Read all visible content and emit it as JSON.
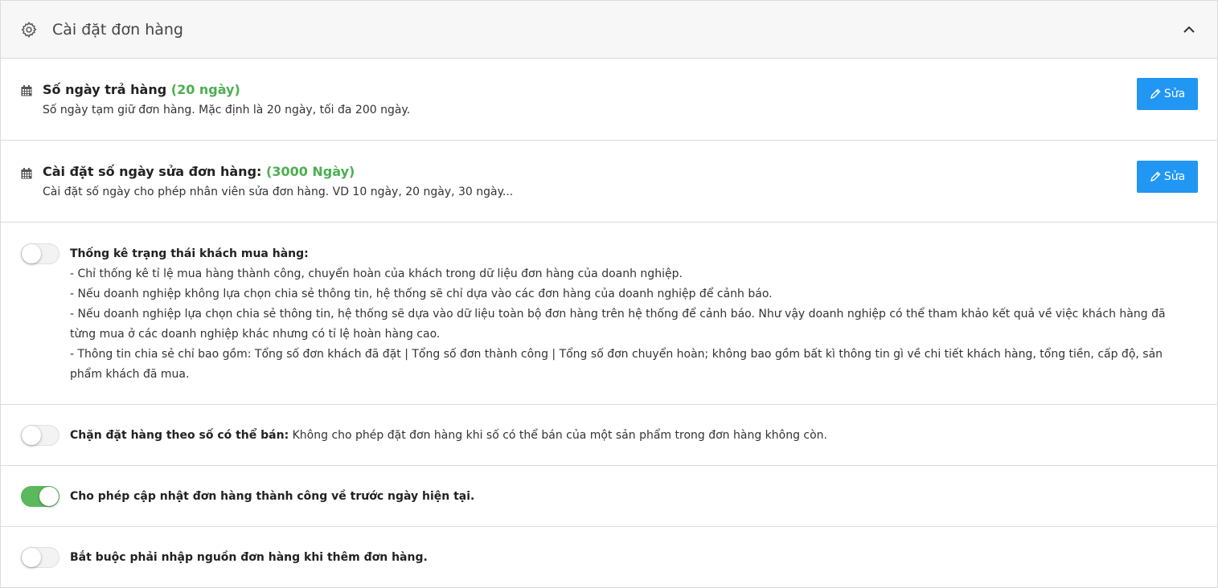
{
  "header": {
    "title": "Cài đặt đơn hàng",
    "icon": "gear-icon",
    "collapse_icon": "chevron-up-icon"
  },
  "return_days": {
    "title": "Số ngày trả hàng",
    "value": "(20 ngày)",
    "description": "Số ngày tạm giữ đơn hàng. Mặc định là 20 ngày, tối đa 200 ngày.",
    "button_label": "Sửa"
  },
  "edit_days": {
    "title": "Cài đặt số ngày sửa đơn hàng:",
    "value": "(3000 Ngày)",
    "description": "Cài đặt số ngày cho phép nhân viên sửa đơn hàng. VD 10 ngày, 20 ngày, 30 ngày...",
    "button_label": "Sửa"
  },
  "customer_stats": {
    "enabled": false,
    "title": "Thống kê trạng thái khách mua hàng:",
    "lines": [
      "- Chỉ thống kê tỉ lệ mua hàng thành công, chuyển hoàn của khách trong dữ liệu đơn hàng của doanh nghiệp.",
      "- Nếu doanh nghiệp không lựa chọn chia sẻ thông tin, hệ thống sẽ chỉ dựa vào các đơn hàng của doanh nghiệp để cảnh báo.",
      "- Nếu doanh nghiệp lựa chọn chia sẻ thông tin, hệ thống sẽ dựa vào dữ liệu toàn bộ đơn hàng trên hệ thống để cảnh báo. Như vậy doanh nghiệp có thể tham khảo kết quả về việc khách hàng đã từng mua ở các doanh nghiệp khác nhưng có tỉ lệ hoàn hàng cao.",
      "- Thông tin chia sẻ chỉ bao gồm: Tổng số đơn khách đã đặt | Tổng số đơn thành công | Tổng số đơn chuyển hoàn; không bao gồm bất kì thông tin gì về chi tiết khách hàng, tổng tiền, cấp độ, sản phẩm khách đã mua."
    ]
  },
  "block_order": {
    "enabled": false,
    "title": "Chặn đặt hàng theo số có thể bán:",
    "description": " Không cho phép đặt đơn hàng khi số có thể bán của một sản phẩm trong đơn hàng không còn."
  },
  "allow_update": {
    "enabled": true,
    "title": "Cho phép cập nhật đơn hàng thành công về trước ngày hiện tại."
  },
  "require_source": {
    "enabled": false,
    "title": "Bắt buộc phải nhập nguồn đơn hàng khi thêm đơn hàng."
  },
  "colors": {
    "accent_green": "#4caf50",
    "button_blue": "#2196f3",
    "toggle_on": "#5cb85c"
  }
}
